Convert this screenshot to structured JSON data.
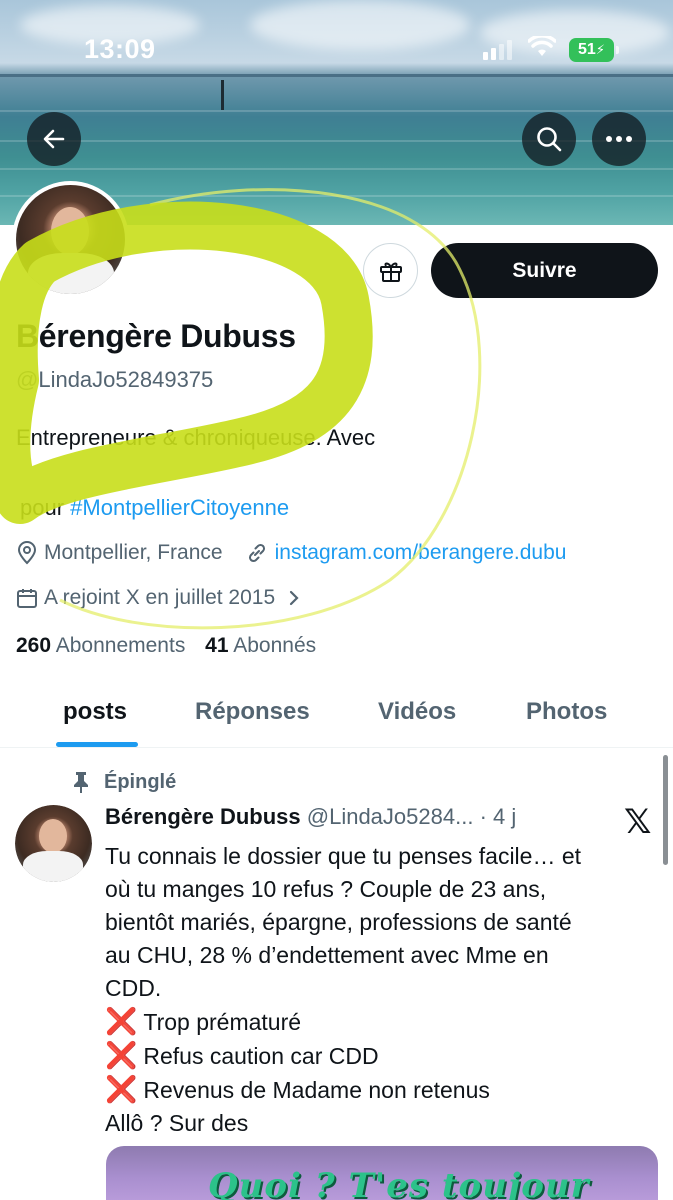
{
  "status_bar": {
    "time": "13:09",
    "battery": "51"
  },
  "banner": {
    "back_icon": "arrow-left-icon",
    "search_icon": "search-icon",
    "more_icon": "more-horizontal-icon"
  },
  "profile": {
    "name": "Bérengère Dubuss",
    "handle": "@LindaJo52849375",
    "bio_line1": "Entrepreneure & chroniqueuse. Avec",
    "bio_line2_prefix": "pour ",
    "bio_hashtag": "#MontpellierCitoyenne",
    "location": "Montpellier, France",
    "website": "instagram.com/berangere.dubu",
    "joined": "A rejoint X en juillet 2015",
    "following_count": "260",
    "following_label": "Abonnements",
    "followers_count": "41",
    "followers_label": "Abonnés",
    "follow_label": "Suivre",
    "gift_icon": "gift-icon"
  },
  "tabs": [
    {
      "label": "posts",
      "active": true
    },
    {
      "label": "Réponses",
      "active": false
    },
    {
      "label": "Vidéos",
      "active": false
    },
    {
      "label": "Photos",
      "active": false
    }
  ],
  "post": {
    "pinned_label": "Épinglé",
    "author_name": "Bérengère Dubuss",
    "author_handle": "@LindaJo5284...",
    "time": "· 4 j",
    "lines": [
      "Tu connais le dossier que tu penses facile… et",
      "où tu manges 10 refus ? Couple de 23 ans,",
      "bientôt mariés, épargne, professions de santé",
      "au CHU, 28 % d’endettement avec Mme en",
      "CDD."
    ],
    "bullet_mark": "❌",
    "bullets": [
      "Trop prématuré",
      "Refus caution car CDD",
      "Revenus de Madame non retenus"
    ],
    "last_line": "Allô ? Sur des",
    "media_text": "Quoi ? T'es toujour"
  },
  "colors": {
    "accent": "#1d9bf0",
    "highlighter": "#c8de1a",
    "follow_bg": "#0f1419"
  }
}
